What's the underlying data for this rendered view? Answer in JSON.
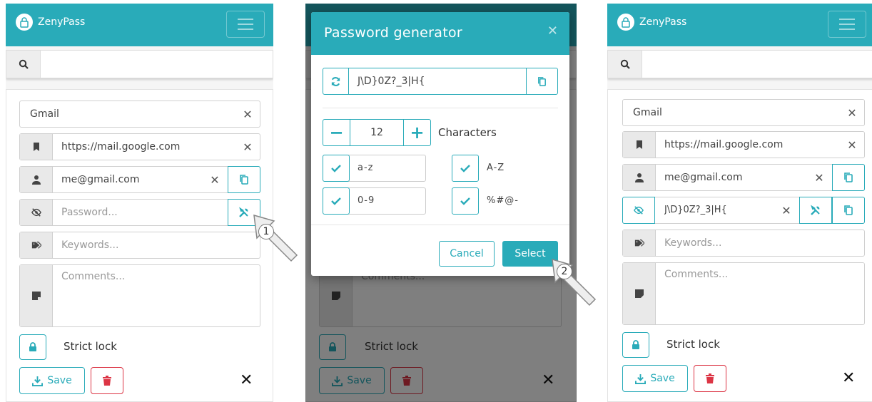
{
  "app": {
    "name": "ZenyPass"
  },
  "search": {
    "placeholder": ""
  },
  "entry": {
    "title": "Gmail",
    "url": "https://mail.google.com",
    "login": "me@gmail.com",
    "password_placeholder": "Password...",
    "password_value": "J\\D}0Z?_3|H{",
    "keywords_placeholder": "Keywords...",
    "comments_placeholder": "Comments...",
    "strict_lock_label": "Strict lock",
    "save_label": "Save"
  },
  "generator": {
    "title": "Password generator",
    "generated": "J\\D}0Z?_3|H{",
    "length": "12",
    "characters_label": "Characters",
    "options": [
      {
        "label": "a-z",
        "checked": true
      },
      {
        "label": "A-Z",
        "checked": true
      },
      {
        "label": "0-9",
        "checked": true
      },
      {
        "label": "%#@-",
        "checked": true
      }
    ],
    "cancel_label": "Cancel",
    "select_label": "Select"
  },
  "steps": [
    "1",
    "2"
  ],
  "colors": {
    "accent": "#29abb9",
    "danger": "#dc3545",
    "navbar": "#29abb9"
  },
  "icons": [
    "logo-icon",
    "hamburger-icon",
    "search-icon",
    "bookmark-icon",
    "user-icon",
    "eye-slash-icon",
    "tags-icon",
    "note-icon",
    "lock-icon",
    "wrench-icon",
    "copy-icon",
    "refresh-icon",
    "check-icon",
    "download-icon",
    "trash-icon",
    "close-icon",
    "pointer-arrow-icon"
  ]
}
